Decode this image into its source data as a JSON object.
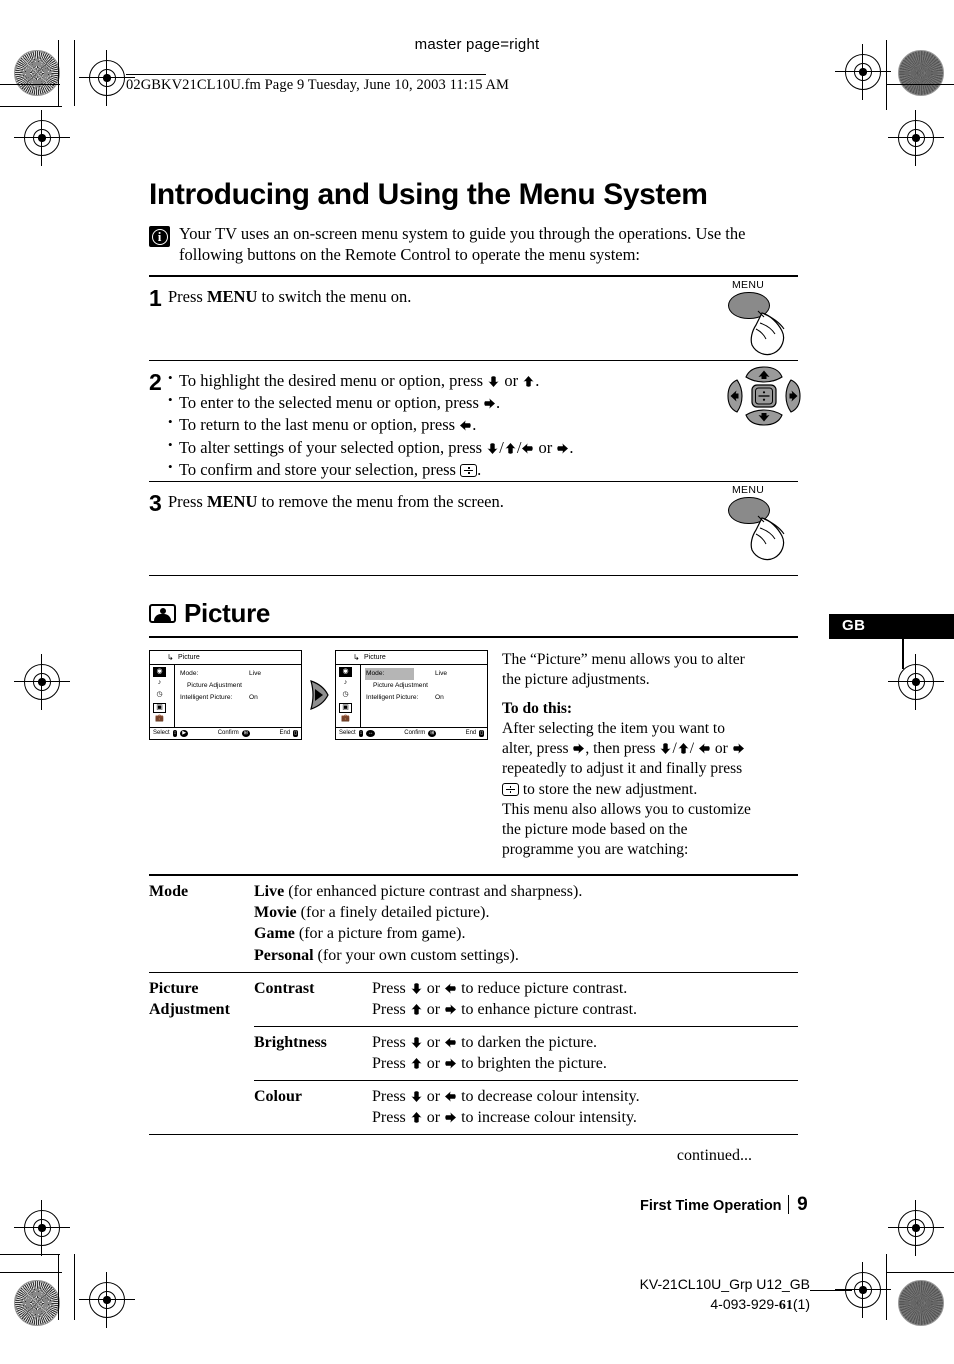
{
  "print_marks": {
    "master_page": "master page=right",
    "file_line": "02GBKV21CL10U.fm  Page 9  Tuesday, June 10, 2003  11:15 AM"
  },
  "heading": {
    "title": "Introducing and Using the Menu System",
    "info_icon": "info-icon",
    "intro": "Your TV uses an on-screen menu system to guide you through the operations. Use the following buttons on the Remote Control to operate the menu system:"
  },
  "steps": [
    {
      "num": "1",
      "text_before": "Press ",
      "bold": "MENU",
      "text_after": " to switch the menu on.",
      "illustration": "menu-button-press"
    },
    {
      "num": "2",
      "bullets": [
        {
          "pre": "To highlight the desired menu or option, press ",
          "icons": [
            "down",
            "or",
            "up"
          ],
          "post": "."
        },
        {
          "pre": "To enter to the selected menu or option, press ",
          "icons": [
            "right"
          ],
          "post": "."
        },
        {
          "pre": "To return to the last menu or option, press ",
          "icons": [
            "left"
          ],
          "post": "."
        },
        {
          "pre": "To alter settings of your selected option, press ",
          "icons": [
            "down",
            "slash",
            "up",
            "slash",
            "left",
            "or",
            "right"
          ],
          "post": "."
        },
        {
          "pre": "To confirm and store your selection, press ",
          "icons": [
            "enter"
          ],
          "post": "."
        }
      ],
      "illustration": "dpad-navigation"
    },
    {
      "num": "3",
      "text_before": "Press ",
      "bold": "MENU",
      "text_after": " to remove the menu from the screen.",
      "illustration": "menu-button-press"
    }
  ],
  "remote": {
    "menu_label": "MENU"
  },
  "section": {
    "icon": "picture-icon",
    "title": "Picture",
    "gb_tab": "GB"
  },
  "osd": {
    "title": "Picture",
    "return_icon": "return-arrow-icon",
    "side_icons": [
      "picture-icon",
      "sound-icon",
      "timer-icon",
      "screen-icon",
      "setup-icon"
    ],
    "rows": [
      {
        "label": "Mode:",
        "value": "Live"
      },
      {
        "label": "Picture Adjustment",
        "value": ""
      },
      {
        "label": "Intelligent Picture:",
        "value": "On"
      }
    ],
    "footer": {
      "select": "Select",
      "confirm": "Confirm",
      "end": "End"
    },
    "transition_arrow": "right-arrow-icon"
  },
  "description": {
    "p1": "The “Picture” menu allows you to alter the picture adjustments.",
    "todo_heading": "To do this:",
    "p2_a": "After selecting the item you want to alter, press ",
    "p2_b": ", then press ",
    "p2_c": " or ",
    "p2_d": " repeatedly to adjust it and finally press ",
    "p2_e": " to store the new adjustment.",
    "p3": "This menu also allows you to customize the picture mode based on the programme you are watching:"
  },
  "table": {
    "mode": {
      "label": "Mode",
      "options": [
        {
          "name": "Live",
          "desc": " (for enhanced picture contrast and sharpness)."
        },
        {
          "name": "Movie",
          "desc": " (for a finely detailed picture)."
        },
        {
          "name": "Game",
          "desc": " (for a picture from game)."
        },
        {
          "name": "Personal",
          "desc": " (for your own custom settings)."
        }
      ]
    },
    "picture_adjustment": {
      "label_line1": "Picture",
      "label_line2": "Adjustment",
      "items": [
        {
          "name": "Contrast",
          "lines": [
            {
              "pre": "Press ",
              "mid": " or ",
              "post": " to reduce picture contrast.",
              "icons": [
                "down",
                "left"
              ]
            },
            {
              "pre": "Press ",
              "mid": " or ",
              "post": " to enhance picture contrast.",
              "icons": [
                "up",
                "right"
              ]
            }
          ]
        },
        {
          "name": "Brightness",
          "lines": [
            {
              "pre": "Press ",
              "mid": " or ",
              "post": " to darken the picture.",
              "icons": [
                "down",
                "left"
              ]
            },
            {
              "pre": "Press ",
              "mid": " or ",
              "post": " to brighten the picture.",
              "icons": [
                "up",
                "right"
              ]
            }
          ]
        },
        {
          "name": "Colour",
          "lines": [
            {
              "pre": "Press ",
              "mid": " or ",
              "post": " to decrease colour intensity.",
              "icons": [
                "down",
                "left"
              ]
            },
            {
              "pre": "Press ",
              "mid": " or ",
              "post": " to increase colour intensity.",
              "icons": [
                "up",
                "right"
              ]
            }
          ]
        }
      ]
    },
    "continued": "continued..."
  },
  "footer": {
    "chapter": "First Time Operation",
    "page": "9",
    "model": "KV-21CL10U_Grp U12_GB",
    "doc_number_pre": "4-093-929-",
    "doc_number_bold": "61",
    "doc_number_post": "(1)"
  }
}
